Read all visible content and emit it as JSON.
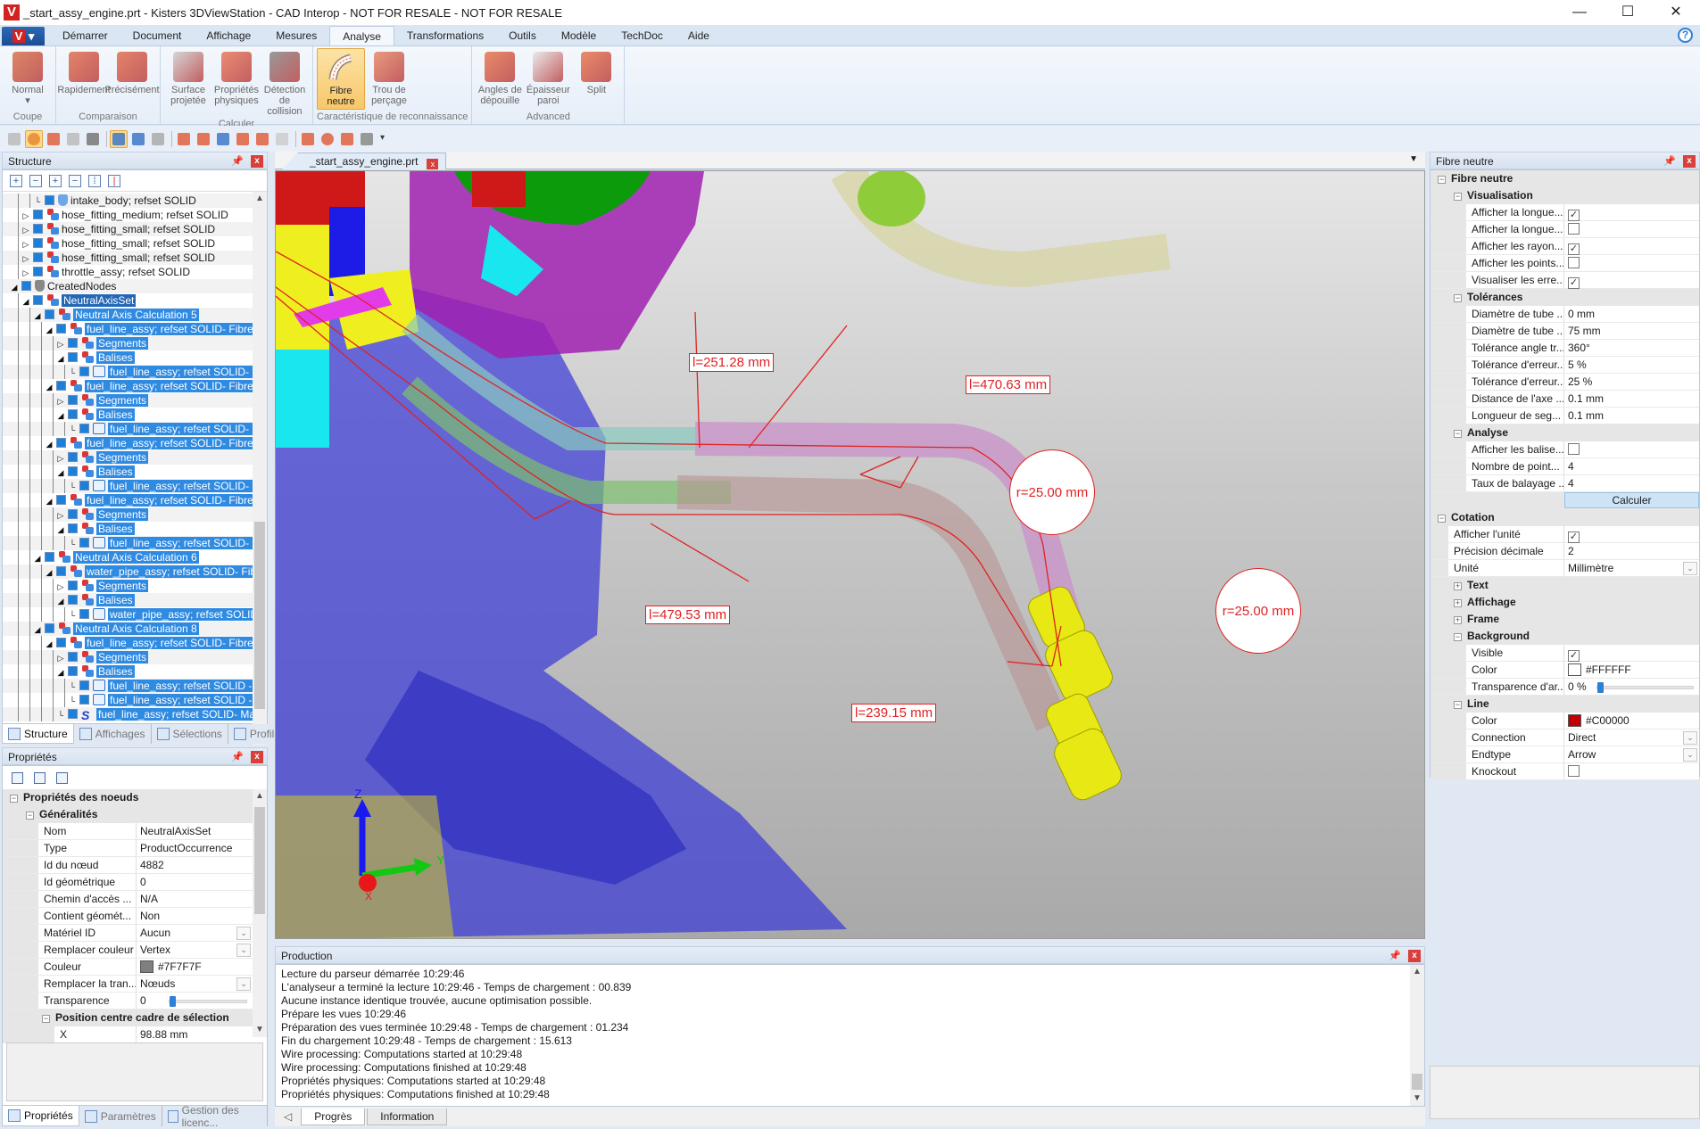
{
  "window": {
    "title": "_start_assy_engine.prt - Kisters 3DViewStation - CAD Interop - NOT FOR RESALE - NOT FOR RESALE",
    "app_logo": "V",
    "controls": {
      "minimize": "—",
      "maximize": "☐",
      "close": "✕"
    }
  },
  "menu": {
    "app_button": "V",
    "tabs": [
      {
        "label": "Démarrer",
        "active": false
      },
      {
        "label": "Document",
        "active": false
      },
      {
        "label": "Affichage",
        "active": false
      },
      {
        "label": "Mesures",
        "active": false
      },
      {
        "label": "Analyse",
        "active": true
      },
      {
        "label": "Transformations",
        "active": false
      },
      {
        "label": "Outils",
        "active": false
      },
      {
        "label": "Modèle",
        "active": false
      },
      {
        "label": "TechDoc",
        "active": false
      },
      {
        "label": "Aide",
        "active": false
      }
    ],
    "help": "?"
  },
  "ribbon": {
    "groups": [
      {
        "label": "Coupe",
        "buttons": [
          {
            "label": "Normal",
            "sub": "▾",
            "icon": "section-cut-icon"
          }
        ]
      },
      {
        "label": "Comparaison",
        "buttons": [
          {
            "label": "Rapidement",
            "icon": "compare-fast-icon"
          },
          {
            "label": "Précisément",
            "icon": "compare-precise-icon"
          }
        ]
      },
      {
        "label": "Calculer",
        "buttons": [
          {
            "label": "Surface projetée",
            "icon": "projected-surface-icon"
          },
          {
            "label": "Propriétés physiques",
            "icon": "physical-properties-icon"
          },
          {
            "label": "Détection de collision",
            "icon": "collision-detection-icon"
          }
        ]
      },
      {
        "label": "Caractéristique de reconnaissance",
        "buttons": [
          {
            "label": "Fibre neutre",
            "icon": "neutral-fiber-icon",
            "active": true
          },
          {
            "label": "Trou de perçage",
            "icon": "drill-hole-icon"
          }
        ]
      },
      {
        "label": "Advanced",
        "buttons": [
          {
            "label": "Angles de dépouille",
            "icon": "draft-angle-icon"
          },
          {
            "label": "Épaisseur paroi",
            "icon": "wall-thickness-icon"
          },
          {
            "label": "Split",
            "icon": "split-icon"
          }
        ]
      }
    ]
  },
  "toolbar": {
    "tools": [
      "zoom-box",
      "rotate",
      "pan",
      "select-box",
      "zoom",
      "select-part",
      "select-face",
      "select-edge",
      "view-front",
      "view-back",
      "view-top",
      "view-left",
      "view-iso",
      "view-right",
      "annotation",
      "rotate-view",
      "frame",
      "measure",
      "more"
    ]
  },
  "structure": {
    "title": "Structure",
    "tree": [
      {
        "depth": 3,
        "expander": "",
        "icon": "shield",
        "label": "intake_body; refset SOLID",
        "selected": false
      },
      {
        "depth": 2,
        "expander": "▷",
        "icon": "asm",
        "label": "hose_fitting_medium; refset SOLID",
        "selected": false
      },
      {
        "depth": 2,
        "expander": "▷",
        "icon": "asm",
        "label": "hose_fitting_small; refset SOLID",
        "selected": false
      },
      {
        "depth": 2,
        "expander": "▷",
        "icon": "asm",
        "label": "hose_fitting_small; refset SOLID",
        "selected": false
      },
      {
        "depth": 2,
        "expander": "▷",
        "icon": "asm",
        "label": "hose_fitting_small; refset SOLID",
        "selected": false
      },
      {
        "depth": 2,
        "expander": "▷",
        "icon": "asm",
        "label": "throttle_assy; refset SOLID",
        "selected": false
      },
      {
        "depth": 1,
        "expander": "◢",
        "icon": "grey",
        "label": "CreatedNodes",
        "selected": false
      },
      {
        "depth": 2,
        "expander": "◢",
        "icon": "asm",
        "label": "NeutralAxisSet",
        "selected": true,
        "dark": true
      },
      {
        "depth": 3,
        "expander": "◢",
        "icon": "asm",
        "label": "Neutral Axis Calculation 5",
        "selected": true
      },
      {
        "depth": 4,
        "expander": "◢",
        "icon": "asm",
        "label": "fuel_line_assy; refset SOLID- Fibre neutre",
        "selected": true
      },
      {
        "depth": 5,
        "expander": "▷",
        "icon": "asm",
        "label": "Segments",
        "selected": true
      },
      {
        "depth": 5,
        "expander": "◢",
        "icon": "asm",
        "label": "Balises",
        "selected": true
      },
      {
        "depth": 6,
        "expander": "",
        "icon": "note",
        "label": "fuel_line_assy; refset SOLID- Longueur",
        "selected": true
      },
      {
        "depth": 4,
        "expander": "◢",
        "icon": "asm",
        "label": "fuel_line_assy; refset SOLID- Fibre neutre",
        "selected": true
      },
      {
        "depth": 5,
        "expander": "▷",
        "icon": "asm",
        "label": "Segments",
        "selected": true
      },
      {
        "depth": 5,
        "expander": "◢",
        "icon": "asm",
        "label": "Balises",
        "selected": true
      },
      {
        "depth": 6,
        "expander": "",
        "icon": "note",
        "label": "fuel_line_assy; refset SOLID- Longueur",
        "selected": true
      },
      {
        "depth": 4,
        "expander": "◢",
        "icon": "asm",
        "label": "fuel_line_assy; refset SOLID- Fibre neutre",
        "selected": true
      },
      {
        "depth": 5,
        "expander": "▷",
        "icon": "asm",
        "label": "Segments",
        "selected": true
      },
      {
        "depth": 5,
        "expander": "◢",
        "icon": "asm",
        "label": "Balises",
        "selected": true
      },
      {
        "depth": 6,
        "expander": "",
        "icon": "note",
        "label": "fuel_line_assy; refset SOLID- Longueur",
        "selected": true
      },
      {
        "depth": 4,
        "expander": "◢",
        "icon": "asm",
        "label": "fuel_line_assy; refset SOLID- Fibre neutre",
        "selected": true
      },
      {
        "depth": 5,
        "expander": "▷",
        "icon": "asm",
        "label": "Segments",
        "selected": true
      },
      {
        "depth": 5,
        "expander": "◢",
        "icon": "asm",
        "label": "Balises",
        "selected": true
      },
      {
        "depth": 6,
        "expander": "",
        "icon": "note",
        "label": "fuel_line_assy; refset SOLID- Longueur",
        "selected": true
      },
      {
        "depth": 3,
        "expander": "◢",
        "icon": "asm",
        "label": "Neutral Axis Calculation 6",
        "selected": true
      },
      {
        "depth": 4,
        "expander": "◢",
        "icon": "asm",
        "label": "water_pipe_assy; refset SOLID- Fibre neutre",
        "selected": true
      },
      {
        "depth": 5,
        "expander": "▷",
        "icon": "asm",
        "label": "Segments",
        "selected": true
      },
      {
        "depth": 5,
        "expander": "◢",
        "icon": "asm",
        "label": "Balises",
        "selected": true
      },
      {
        "depth": 6,
        "expander": "",
        "icon": "note",
        "label": "water_pipe_assy; refset SOLID- Longueur",
        "selected": true
      },
      {
        "depth": 3,
        "expander": "◢",
        "icon": "asm",
        "label": "Neutral Axis Calculation 8",
        "selected": true
      },
      {
        "depth": 4,
        "expander": "◢",
        "icon": "asm",
        "label": "fuel_line_assy; refset SOLID- Fibre neutre",
        "selected": true
      },
      {
        "depth": 5,
        "expander": "▷",
        "icon": "asm",
        "label": "Segments",
        "selected": true
      },
      {
        "depth": 5,
        "expander": "◢",
        "icon": "asm",
        "label": "Balises",
        "selected": true
      },
      {
        "depth": 6,
        "expander": "",
        "icon": "note",
        "label": "fuel_line_assy; refset SOLID - Rayon",
        "selected": true
      },
      {
        "depth": 6,
        "expander": "",
        "icon": "note",
        "label": "fuel_line_assy; refset SOLID - Rayon",
        "selected": true
      },
      {
        "depth": 5,
        "expander": "",
        "icon": "wave",
        "label": "fuel_line_assy; refset SOLID- Marquage",
        "selected": true
      }
    ],
    "tabs": [
      {
        "label": "Structure",
        "active": true
      },
      {
        "label": "Affichages",
        "active": false
      },
      {
        "label": "Sélections",
        "active": false
      },
      {
        "label": "Profil",
        "active": false
      }
    ]
  },
  "properties": {
    "title": "Propriétés",
    "root": "Propriétés des noeuds",
    "section": "Généralités",
    "rows": [
      {
        "key": "Nom",
        "value": "NeutralAxisSet"
      },
      {
        "key": "Type",
        "value": "ProductOccurrence"
      },
      {
        "key": "Id du nœud",
        "value": "4882"
      },
      {
        "key": "Id géométrique",
        "value": "0"
      },
      {
        "key": "Chemin d'accès ...",
        "value": "N/A"
      },
      {
        "key": "Contient géomét...",
        "value": "Non"
      },
      {
        "key": "Matériel ID",
        "value": "Aucun",
        "dropdown": true
      },
      {
        "key": "Remplacer couleur",
        "value": "Vertex",
        "dropdown": true
      },
      {
        "key": "Couleur",
        "value": "#7F7F7F",
        "swatch": "#7F7F7F"
      },
      {
        "key": "Remplacer la tran...",
        "value": "Nœuds",
        "dropdown": true
      },
      {
        "key": "Transparence",
        "value": "0",
        "slider": 0
      }
    ],
    "section2": "Position centre cadre de sélection",
    "rows2": [
      {
        "key": "X",
        "value": "98.88 mm"
      }
    ],
    "tabs": [
      {
        "label": "Propriétés",
        "active": true
      },
      {
        "label": "Paramètres",
        "active": false
      },
      {
        "label": "Gestion des licenc...",
        "active": false
      }
    ]
  },
  "viewport": {
    "tab_label": "_start_assy_engine.prt",
    "annotations": [
      {
        "type": "length",
        "label": "l=251.28 mm"
      },
      {
        "type": "length",
        "label": "l=470.63 mm"
      },
      {
        "type": "length",
        "label": "l=479.53 mm"
      },
      {
        "type": "length",
        "label": "l=239.15 mm"
      },
      {
        "type": "radius",
        "label": "r=25.00 mm"
      },
      {
        "type": "radius",
        "label": "r=25.00 mm"
      }
    ],
    "axes": {
      "x": "X",
      "y": "Y",
      "z": "Z"
    }
  },
  "production": {
    "title": "Production",
    "lines": [
      "Lecture du parseur démarrée 10:29:46",
      "L'analyseur a terminé la lecture 10:29:46 - Temps de chargement : 00.839",
      "Aucune instance identique trouvée, aucune optimisation possible.",
      "Prépare les vues 10:29:46",
      "Préparation des vues terminée 10:29:48 - Temps de chargement : 01.234",
      "Fin du chargement 10:29:48 - Temps de chargement : 15.613",
      "Wire processing: Computations started at 10:29:48",
      "Wire processing: Computations finished at 10:29:48",
      "Propriétés physiques: Computations started at 10:29:48",
      "Propriétés physiques: Computations finished at 10:29:48"
    ],
    "tabs": [
      {
        "label": "Progrès",
        "active": true
      },
      {
        "label": "Information",
        "active": false
      }
    ]
  },
  "neutral_fiber": {
    "title": "Fibre neutre",
    "root": "Fibre neutre",
    "visualisation": {
      "label": "Visualisation",
      "rows": [
        {
          "key": "Afficher la longue...",
          "checked": true
        },
        {
          "key": "Afficher la longue...",
          "checked": false
        },
        {
          "key": "Afficher les rayon...",
          "checked": true
        },
        {
          "key": "Afficher les points...",
          "checked": false
        },
        {
          "key": "Visualiser les erre...",
          "checked": true
        }
      ]
    },
    "tolerances": {
      "label": "Tolérances",
      "rows": [
        {
          "key": "Diamètre de tube ...",
          "value": "0 mm"
        },
        {
          "key": "Diamètre de tube ...",
          "value": "75 mm"
        },
        {
          "key": "Tolérance angle tr...",
          "value": "360°"
        },
        {
          "key": "Tolérance d'erreur...",
          "value": "5 %"
        },
        {
          "key": "Tolérance d'erreur...",
          "value": "25 %"
        },
        {
          "key": "Distance de l'axe ...",
          "value": "0.1 mm"
        },
        {
          "key": "Longueur de seg...",
          "value": "0.1 mm"
        }
      ]
    },
    "analyse": {
      "label": "Analyse",
      "rows": [
        {
          "key": "Afficher les balise...",
          "checked": false
        },
        {
          "key": "Nombre de point...",
          "value": "4"
        },
        {
          "key": "Taux de balayage ...",
          "value": "4"
        }
      ]
    },
    "calculate_button": "Calculer",
    "cotation": {
      "label": "Cotation",
      "rows": [
        {
          "key": "Afficher l'unité",
          "checked": true
        },
        {
          "key": "Précision décimale",
          "value": "2"
        },
        {
          "key": "Unité",
          "value": "Millimètre",
          "dropdown": true
        }
      ],
      "collapsed": [
        "Text",
        "Affichage",
        "Frame"
      ],
      "background": {
        "label": "Background",
        "rows": [
          {
            "key": "Visible",
            "checked": true
          },
          {
            "key": "Color",
            "value": "#FFFFFF",
            "swatch": "#FFFFFF"
          },
          {
            "key": "Transparence d'ar...",
            "value": "0 %",
            "slider": 0
          }
        ]
      },
      "line": {
        "label": "Line",
        "rows": [
          {
            "key": "Color",
            "value": "#C00000",
            "swatch": "#C00000"
          },
          {
            "key": "Connection",
            "value": "Direct",
            "dropdown": true
          },
          {
            "key": "Endtype",
            "value": "Arrow",
            "dropdown": true
          },
          {
            "key": "Knockout",
            "checked": false
          }
        ]
      }
    }
  },
  "colors": {
    "accent": "#2F8AE2",
    "annotation": "#E12121",
    "active_ribbon": "#F7C76A"
  }
}
